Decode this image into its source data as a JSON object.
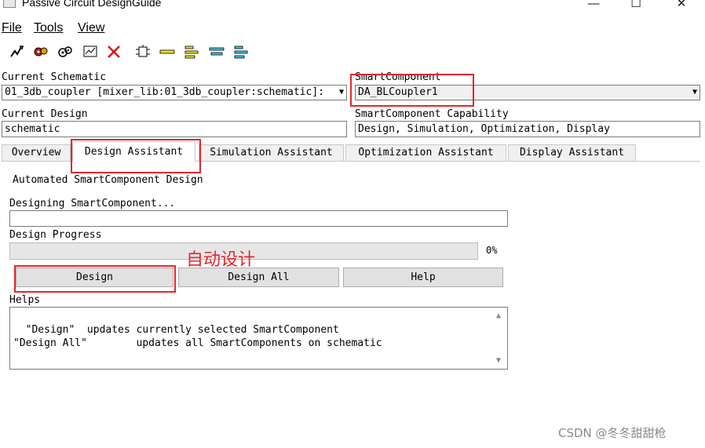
{
  "window": {
    "title": "Passive Circuit DesignGuide",
    "controls": {
      "minimize": "—",
      "maximize": "☐",
      "close": "✕"
    }
  },
  "menu": {
    "file": "File",
    "tools": "Tools",
    "view": "View"
  },
  "toolbar": {
    "icons": [
      "design-icon",
      "design-all-icon",
      "optimize-icon",
      "display-icon",
      "delete-icon",
      "component-icon",
      "align-top-icon",
      "align-left-icon",
      "align-center-icon",
      "align-right-icon"
    ]
  },
  "schematic": {
    "label": "Current Schematic",
    "value": "01_3db_coupler [mixer_lib:01_3db_coupler:schematic]:",
    "arrow": "▼"
  },
  "smart_component": {
    "label": "SmartComponent",
    "value": "DA_BLCoupler1",
    "arrow": "▼"
  },
  "design": {
    "label": "Current Design",
    "value": "schematic"
  },
  "capability": {
    "label": "SmartComponent Capability",
    "value": "Design, Simulation, Optimization, Display"
  },
  "tabs": [
    {
      "label": "Overview"
    },
    {
      "label": "Design Assistant"
    },
    {
      "label": "Simulation Assistant"
    },
    {
      "label": "Optimization Assistant"
    },
    {
      "label": "Display Assistant"
    }
  ],
  "active_tab": "Design Assistant",
  "panel": {
    "heading": "Automated SmartComponent Design",
    "designing_label": "Designing SmartComponent...",
    "designing_value": "",
    "progress_label": "Design Progress",
    "progress_text": "0%",
    "progress_fraction": 0,
    "buttons": {
      "design": "Design",
      "design_all": "Design All",
      "help": "Help"
    },
    "helps_label": "Helps",
    "helps_text": "\"Design\"  updates currently selected SmartComponent\n\"Design All\"        updates all SmartComponents on schematic"
  },
  "annotation": "自动设计",
  "watermark": "CSDN @冬冬甜甜枪",
  "colors": {
    "highlight": "#e0282e",
    "window_bg": "#ffffff",
    "tab_bg": "#f0f0f0",
    "button_bg": "#e1e1e1"
  }
}
